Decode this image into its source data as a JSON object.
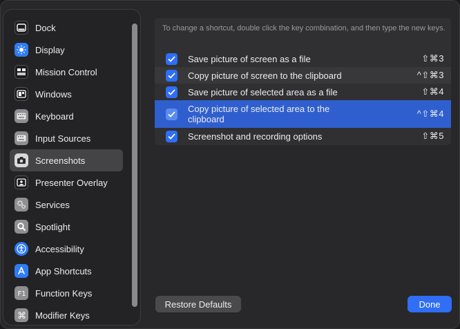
{
  "sidebar": {
    "items": [
      {
        "label": "Dock",
        "icon": "dock-icon",
        "color": "#1c1c1e"
      },
      {
        "label": "Display",
        "icon": "display-icon",
        "color": "#2f7cf6"
      },
      {
        "label": "Mission Control",
        "icon": "mission-control-icon",
        "color": "#1c1c1e"
      },
      {
        "label": "Windows",
        "icon": "windows-icon",
        "color": "#1c1c1e"
      },
      {
        "label": "Keyboard",
        "icon": "keyboard-icon",
        "color": "#8e8e93"
      },
      {
        "label": "Input Sources",
        "icon": "input-sources-icon",
        "color": "#8e8e93"
      },
      {
        "label": "Screenshots",
        "icon": "screenshot-icon",
        "color": "#d8d8da"
      },
      {
        "label": "Presenter Overlay",
        "icon": "presenter-overlay-icon",
        "color": "#1c1c1e"
      },
      {
        "label": "Services",
        "icon": "gear-icon",
        "color": "#8e8e93"
      },
      {
        "label": "Spotlight",
        "icon": "magnifier-icon",
        "color": "#8e8e93"
      },
      {
        "label": "Accessibility",
        "icon": "accessibility-icon",
        "color": "#2f7cf6"
      },
      {
        "label": "App Shortcuts",
        "icon": "app-store-icon",
        "color": "#2f7cf6"
      },
      {
        "label": "Function Keys",
        "icon": "fn-key-icon",
        "color": "#8e8e93"
      },
      {
        "label": "Modifier Keys",
        "icon": "command-key-icon",
        "color": "#8e8e93"
      }
    ],
    "selected_index": 6
  },
  "main": {
    "hint": "To change a shortcut, double click the key combination, and then type the new keys.",
    "shortcuts": [
      {
        "label": "Save picture of screen as a file",
        "keys": "⇧⌘3",
        "checked": true
      },
      {
        "label": "Copy picture of screen to the clipboard",
        "keys": "^⇧⌘3",
        "checked": true
      },
      {
        "label": "Save picture of selected area as a file",
        "keys": "⇧⌘4",
        "checked": true
      },
      {
        "label": "Copy picture of selected area to the clipboard",
        "keys": "^⇧⌘4",
        "checked": true
      },
      {
        "label": "Screenshot and recording options",
        "keys": "⇧⌘5",
        "checked": true
      }
    ]
  },
  "footer": {
    "restore_label": "Restore Defaults",
    "done_label": "Done"
  },
  "colors": {
    "accent": "#2f6ef5",
    "selection": "#2f5fcf"
  }
}
